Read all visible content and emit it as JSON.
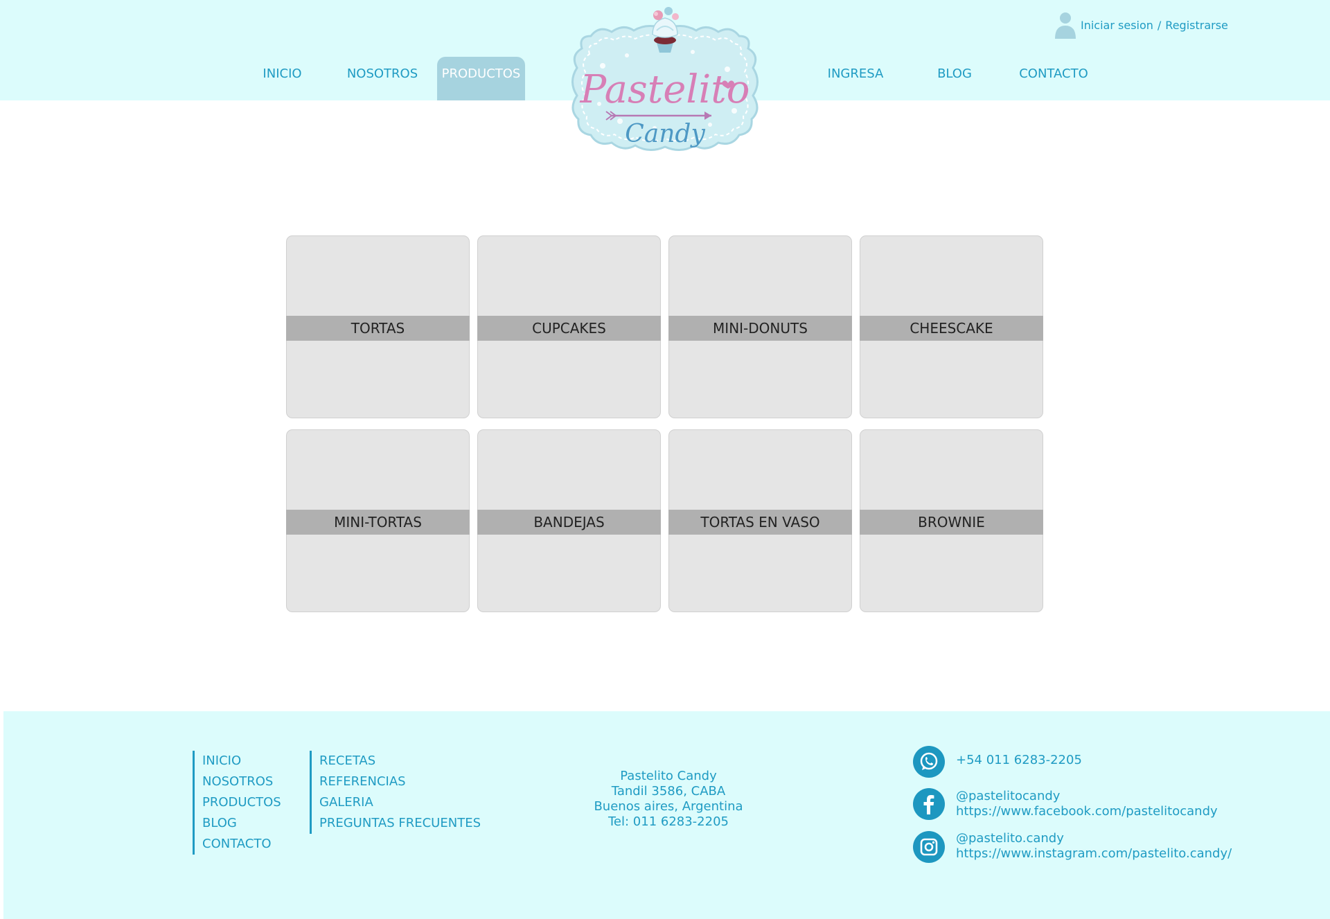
{
  "header": {
    "nav_left": [
      "INICIO",
      "NOSOTROS",
      "PRODUCTOS"
    ],
    "nav_right": [
      "INGRESA",
      "BLOG",
      "CONTACTO"
    ],
    "active": "PRODUCTOS",
    "login_label": "Iniciar sesion",
    "separator": "/",
    "register_label": "Registrarse"
  },
  "logo": {
    "title": "Pastelito",
    "subtitle": "Candy"
  },
  "products": [
    "TORTAS",
    "CUPCAKES",
    "MINI-DONUTS",
    "CHEESCAKE",
    "MINI-TORTAS",
    "BANDEJAS",
    "TORTAS EN VASO",
    "BROWNIE"
  ],
  "footer": {
    "col1": [
      "INICIO",
      "NOSOTROS",
      "PRODUCTOS",
      "BLOG",
      "CONTACTO"
    ],
    "col2": [
      "RECETAS",
      "REFERENCIAS",
      "GALERIA",
      "PREGUNTAS FRECUENTES"
    ],
    "address": [
      "Pastelito Candy",
      "Tandil 3586, CABA",
      "Buenos aires, Argentina",
      "Tel: 011 6283-2205"
    ],
    "whatsapp": "+54 011 6283-2205",
    "facebook_handle": "@pastelitocandy",
    "facebook_url": "https://www.facebook.com/pastelitocandy",
    "instagram_handle": "@pastelito.candy",
    "instagram_url": "https://www.instagram.com/pastelito.candy/"
  },
  "colors": {
    "header_bg": "#dcfcfc",
    "accent": "#1f9bc3",
    "active_tab": "#a6d3df",
    "card_bg": "#e5e5e5",
    "card_band": "#b0b0b0",
    "logo_pink": "#d77fb6"
  }
}
